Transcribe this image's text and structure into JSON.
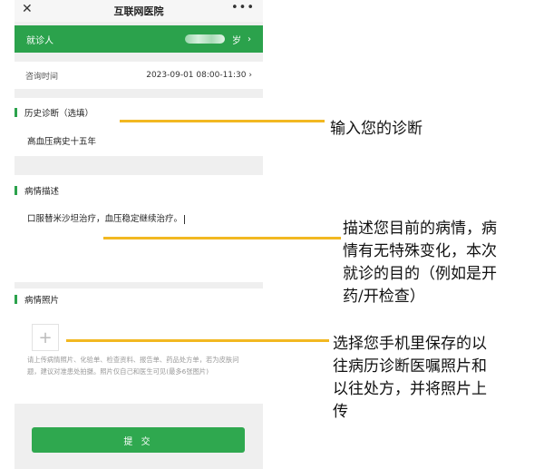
{
  "app": {
    "title": "互联网医院",
    "close_glyph": "✕",
    "more_glyph": "•••"
  },
  "patient": {
    "label": "就诊人",
    "name_suffix": "岁",
    "chevron": "›"
  },
  "consult_time": {
    "label": "咨询时间",
    "value": "2023-09-01 08:00-11:30",
    "chevron": "›"
  },
  "history": {
    "heading": "历史诊断（选填）",
    "value": "高血压病史十五年"
  },
  "description": {
    "heading": "病情描述",
    "value": "口服替米沙坦治疗，血压稳定继续治疗。"
  },
  "photos": {
    "heading": "病情照片",
    "add_glyph": "+",
    "hint": "请上传病情照片、化验单、检查资料、报告单、药品处方单，若为皮肤问题，建议对准患处拍摄。照片仅自己和医生可见(最多6张图片)"
  },
  "submit_label": "提 交",
  "annotations": {
    "diagnosis_note": "输入您的诊断",
    "description_note": [
      "描述您目前的病情，病",
      "情有无特殊变化，本次",
      "就诊的目的（例如是开",
      "药/开检查）"
    ],
    "photo_note": [
      "选择您手机里保存的以",
      "往病历诊断医嘱照片和",
      "以往处方，并将照片上",
      "传"
    ],
    "pointer_color": "#f2b821"
  },
  "colors": {
    "brand_green": "#2ba24c",
    "page_gray": "#efefef"
  }
}
